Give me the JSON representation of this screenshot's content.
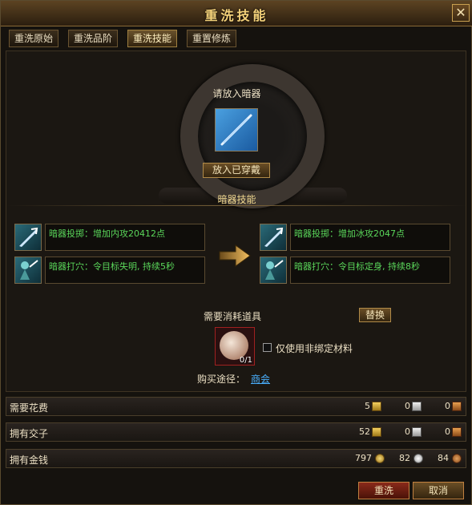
{
  "window": {
    "title": "重洗技能",
    "close_symbol": "✕"
  },
  "tabs": [
    {
      "label": "重洗原始",
      "active": false
    },
    {
      "label": "重洗品阶",
      "active": false
    },
    {
      "label": "重洗技能",
      "active": true
    },
    {
      "label": "重置修炼",
      "active": false
    }
  ],
  "weapon": {
    "prompt": "请放入暗器",
    "equip_button": "放入已穿戴"
  },
  "skills": {
    "section_title": "暗器技能",
    "current": [
      {
        "text": "暗器投掷：增加内攻20412点",
        "icon": "dart-skill-icon"
      },
      {
        "text": "暗器打穴：令目标失明, 持续5秒",
        "icon": "pressure-point-skill-icon"
      }
    ],
    "new": [
      {
        "text": "暗器投掷：增加冰攻2047点",
        "icon": "dart-skill-icon"
      },
      {
        "text": "暗器打穴：令目标定身, 持续8秒",
        "icon": "pressure-point-skill-icon"
      }
    ]
  },
  "materials": {
    "label": "需要消耗道具",
    "replace_button": "替换",
    "item_count": "0/1",
    "bound_checkbox_label": "仅使用非绑定材料",
    "bound_checked": false,
    "buy_label": "购买途径：",
    "buy_link": "商会"
  },
  "costs": [
    {
      "label": "需要花费",
      "values": [
        "5",
        "0",
        "0"
      ],
      "icons": [
        "gold-ticket-icon",
        "silver-ticket-icon",
        "bronze-ticket-icon"
      ]
    },
    {
      "label": "拥有交子",
      "values": [
        "52",
        "0",
        "0"
      ],
      "icons": [
        "gold-ticket-icon",
        "silver-ticket-icon",
        "bronze-ticket-icon"
      ]
    },
    {
      "label": "拥有金钱",
      "values": [
        "797",
        "82",
        "84"
      ],
      "icons": [
        "gold-coin-icon",
        "silver-coin-icon",
        "bronze-coin-icon"
      ]
    }
  ],
  "buttons": {
    "wash": "重洗",
    "cancel": "取消"
  },
  "colors": {
    "accent": "#f4d27a",
    "skill_text": "#5ad65a",
    "link": "#4ab0ff"
  }
}
